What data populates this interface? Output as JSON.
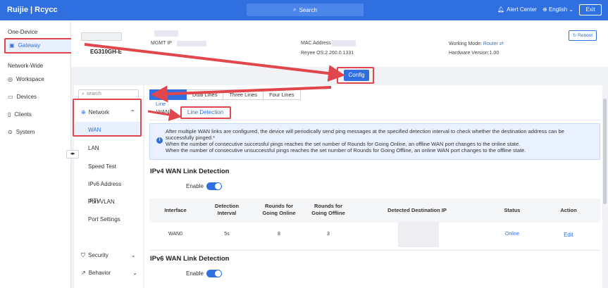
{
  "topbar": {
    "logo": "Ruijie | Rcycc",
    "search_label": "Search",
    "alert_center": "Alert Center",
    "language": "English",
    "exit": "Exit"
  },
  "leftnav": {
    "group_one_device": "One-Device",
    "gateway": "Gateway",
    "group_network_wide": "Network-Wide",
    "workspace": "Workspace",
    "devices": "Devices",
    "clients": "Clients",
    "system": "System"
  },
  "device": {
    "model": "EG310GH-E",
    "mgmt_ip_label": "MGMT IP",
    "mac_label": "MAC Address",
    "os_version": "Reyee OS:2.260.0.1331",
    "working_mode_label": "Working Mode:",
    "working_mode_value": "Router",
    "hardware_version": "Hardware Version:1.00",
    "reboot": "Reboot"
  },
  "config_button": "Config",
  "subnav": {
    "search_placeholder": "search",
    "network": "Network",
    "wan": "WAN",
    "lan": "LAN",
    "speed_test": "Speed Test",
    "ipv6_address": "IPv6 Address",
    "port_vlan": "Port VLAN",
    "port_settings": "Port Settings",
    "iptv": "IPTV",
    "security": "Security",
    "behavior": "Behavior"
  },
  "tabs": [
    "Single Line",
    "Dual Lines",
    "Three Lines",
    "Four Lines"
  ],
  "subtabs": {
    "wan": "WAN",
    "line_detection": "Line Detection"
  },
  "info": {
    "line1": "After multiple WAN links are configured, the device will periodically send ping messages at the specified detection interval to check whether the destination address can be successfully pinged.*",
    "line2": "When the number of consecutive successful pings reaches the set number of Rounds for Going Online, an offline WAN port changes to the online state.",
    "line3": "When the number of consecutive unsuccessful pings reaches the set number of Rounds for Going Offline, an online WAN port changes to the offline state."
  },
  "ipv4": {
    "title": "IPv4 WAN Link Detection",
    "enable_label": "Enable",
    "enabled": true,
    "columns": [
      "Interface",
      "Detection Interval",
      "Rounds for Going Online",
      "Rounds for Going Offline",
      "Detected Destination IP",
      "Status",
      "Action"
    ],
    "rows": [
      {
        "interface": "WAN0",
        "interval": "5s",
        "online": "8",
        "offline": "3",
        "dest_ip": "",
        "status": "Online",
        "action": "Edit"
      }
    ]
  },
  "ipv6": {
    "title": "IPv6 WAN Link Detection",
    "enable_label": "Enable",
    "enabled": true
  },
  "colors": {
    "primary": "#2f6fe0",
    "highlight": "#e0464b"
  }
}
